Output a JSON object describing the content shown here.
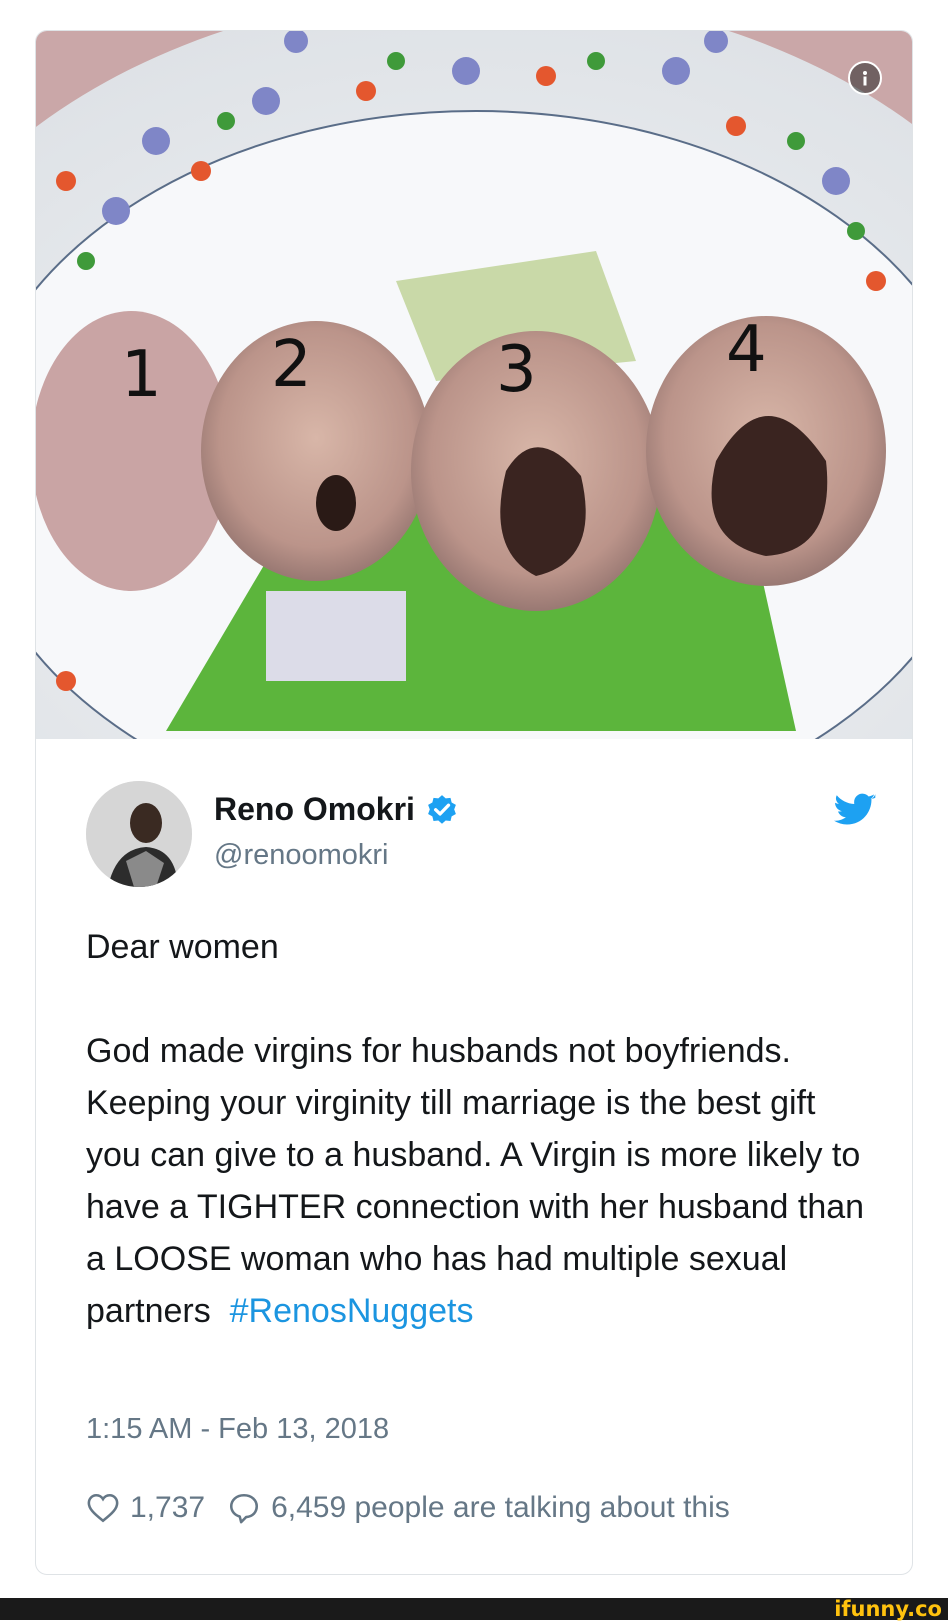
{
  "tweet": {
    "display_name": "Reno Omokri",
    "handle": "@renoomokri",
    "text": "Dear women\n\nGod made virgins for husbands not boyfriends. Keeping your virginity till marriage is the best gift you can give to a husband. A Virgin is more likely to have a TIGHTER connection with her husband than a LOOSE woman who has had multiple sexual partners  ",
    "hashtag": "#RenosNuggets",
    "timestamp": "1:15 AM - Feb 13, 2018",
    "likes": "1,737",
    "replies_text": "6,459 people are talking about this"
  },
  "image": {
    "labels": [
      "1",
      "2",
      "3",
      "4"
    ]
  },
  "icons": {
    "info": "info-icon",
    "verified": "verified-badge-icon",
    "bird": "twitter-bird-icon",
    "heart": "heart-icon",
    "reply": "comment-bubble-icon"
  },
  "colors": {
    "link": "#1b95e0",
    "secondary_text": "#657786",
    "verified": "#1da1f2"
  },
  "watermark": "ifunny.co"
}
